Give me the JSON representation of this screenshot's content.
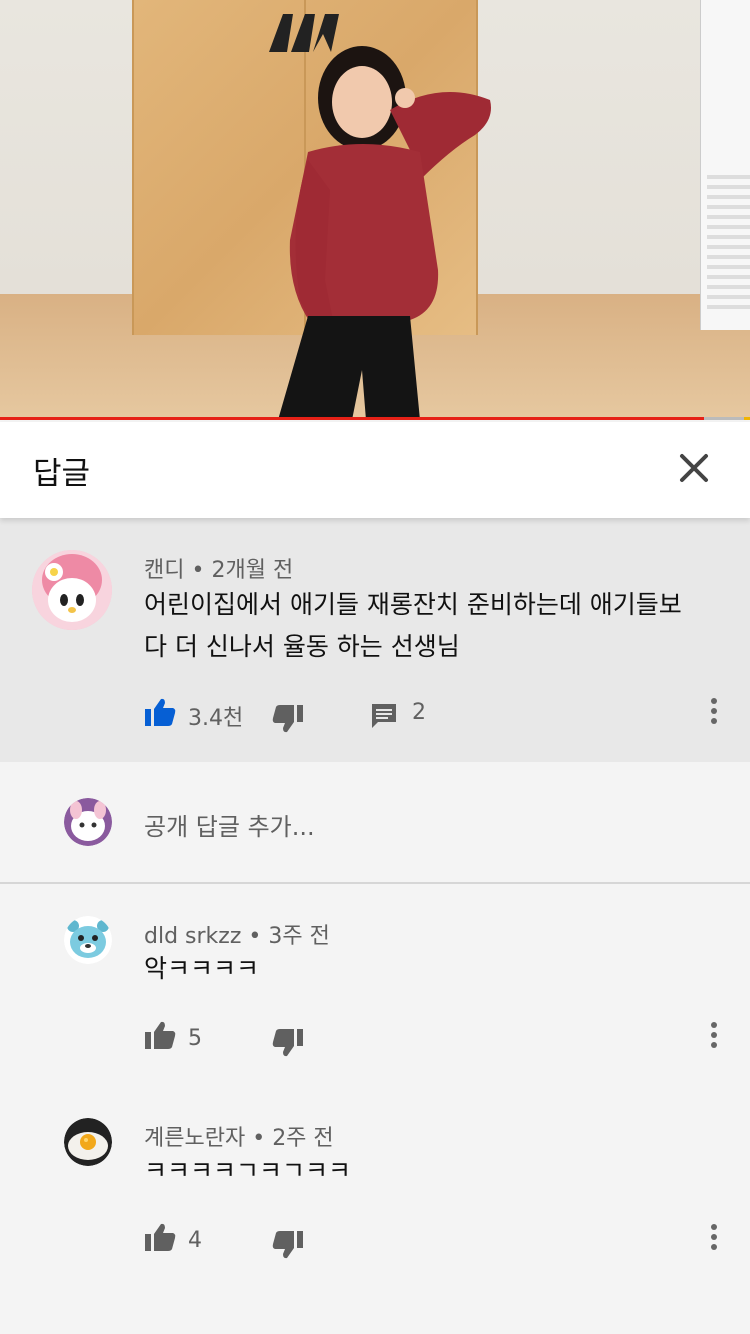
{
  "video": {
    "progress_fraction": 0.938
  },
  "panel": {
    "title": "답글"
  },
  "top_comment": {
    "author": "캔디",
    "time": "2개월 전",
    "text_line1": "어린이집에서 애기들 재롱잔치 준비하는데 애기들보",
    "text_line2": "다 더 신나서 율동 하는 선생님",
    "likes": "3.4천",
    "replies": "2",
    "liked": true
  },
  "reply_input": {
    "placeholder": "공개 답글 추가..."
  },
  "replies": [
    {
      "author": "dld srkzz",
      "time": "3주 전",
      "text": "악ㅋㅋㅋㅋ",
      "likes": "5"
    },
    {
      "author": "계른노란자",
      "time": "2주 전",
      "text": "ㅋㅋㅋㅋㄱㅋㄱㅋㅋ",
      "likes": "4"
    }
  ],
  "icons": {
    "close": "close-icon",
    "like": "thumbs-up-icon",
    "dislike": "thumbs-down-icon",
    "reply": "comment-icon",
    "more": "more-vertical-icon"
  },
  "colors": {
    "accent_red": "#e62117",
    "like_active_blue": "#065fd4",
    "icon_gray": "#606060"
  }
}
